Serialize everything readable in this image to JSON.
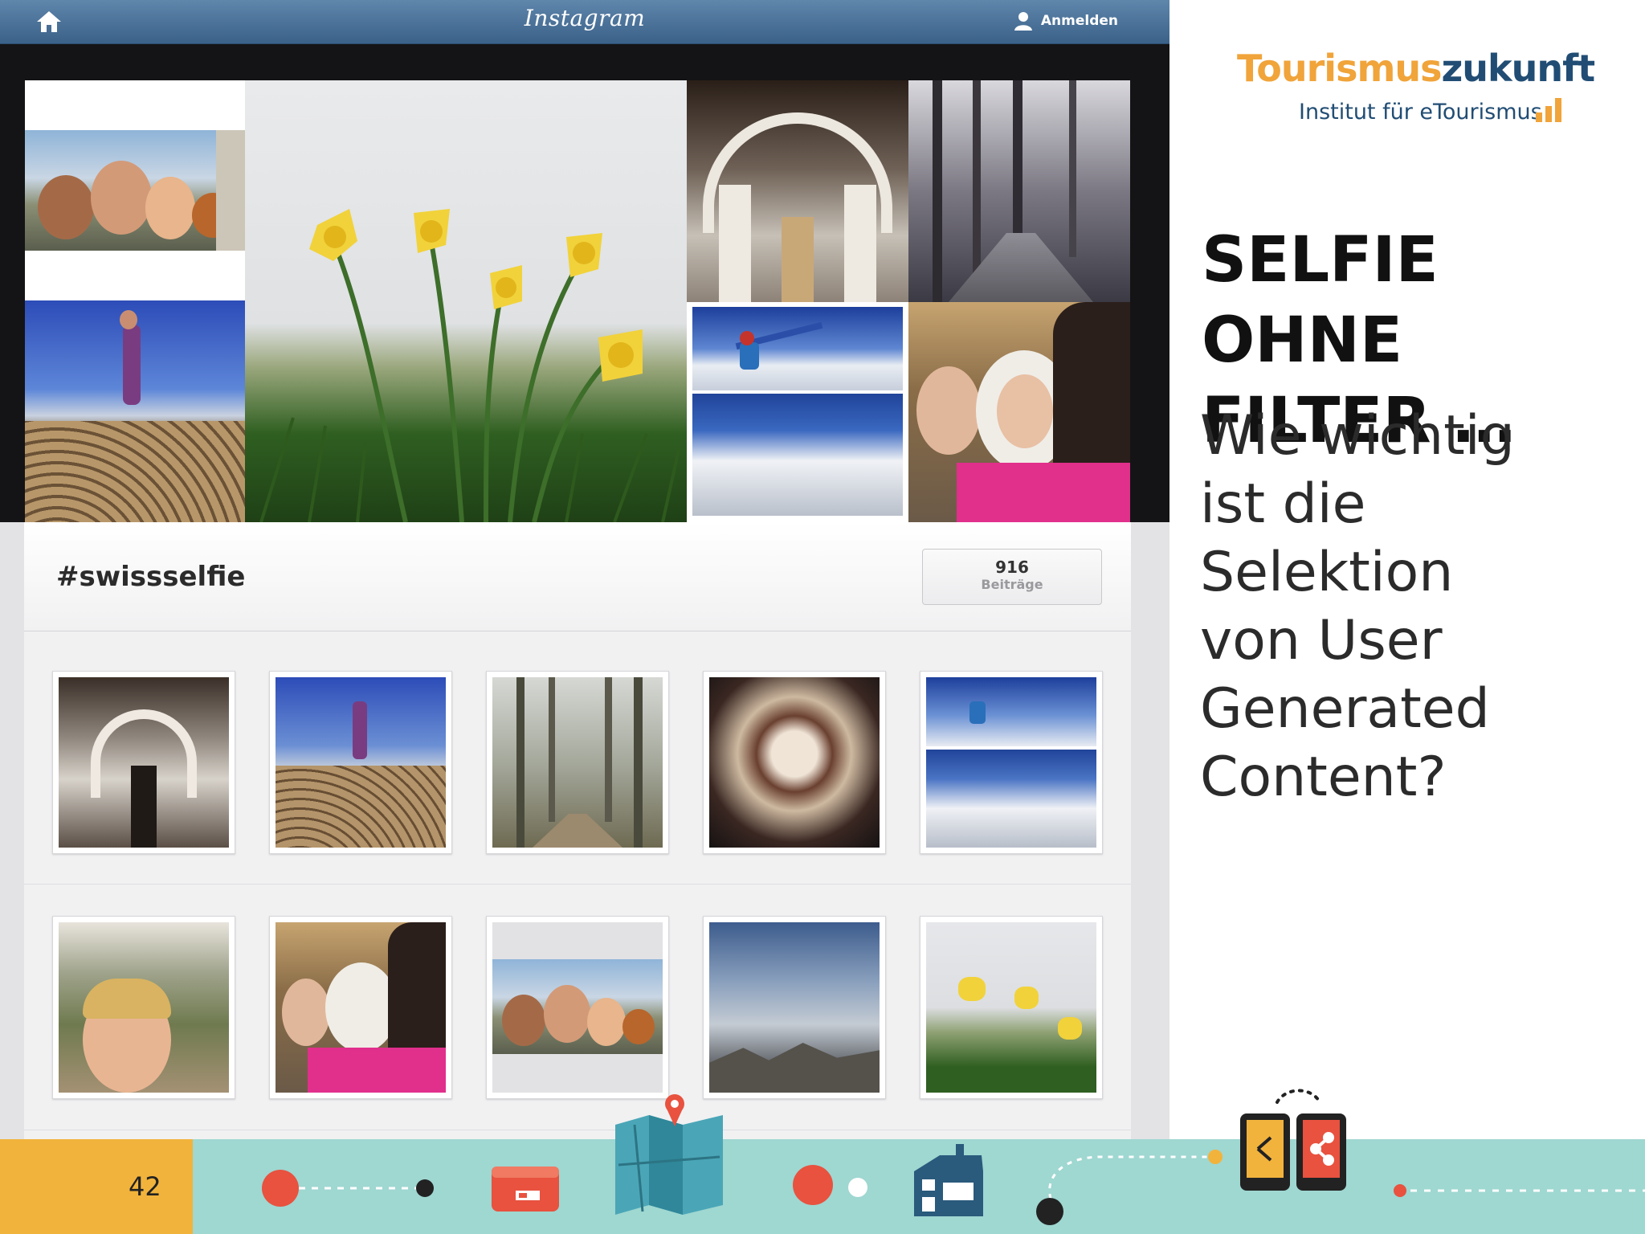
{
  "instagram": {
    "app_title": "Instagram",
    "login_label": "Anmelden",
    "hashtag": "#swissselfie",
    "post_count": "916",
    "post_count_label": "Beiträge",
    "hero_tiles": [
      "friends-selfie",
      "logs-woman",
      "daffodils",
      "church-interior",
      "forest-path",
      "skiers-collage",
      "girls-selfie"
    ],
    "grid_row1": [
      "church-interior",
      "logs-woman",
      "tree-alley",
      "baroque-ceiling",
      "skiers-collage"
    ],
    "grid_row2": [
      "woman-vineyard",
      "girls-selfie",
      "friends-selfie",
      "cloudy-mountains",
      "daffodils"
    ]
  },
  "brand": {
    "name_part1": "Tourismus",
    "name_part2": "zukunft",
    "subtitle": "Institut für eTourismus",
    "color_orange": "#f0a43a",
    "color_blue": "#214d74"
  },
  "slide": {
    "title_line1": "SELFIE OHNE",
    "title_line2": "FILTER …",
    "body_line1": "Wie wichtig",
    "body_line2": "ist die",
    "body_line3": "Selektion",
    "body_line4": "von User",
    "body_line5": "Generated",
    "body_line6": "Content?"
  },
  "footer": {
    "page_number": "42",
    "icons": [
      "red-dot-icon",
      "wallet-icon",
      "map-pin-icon",
      "map-icon",
      "house-icon",
      "phone-share-icon"
    ]
  }
}
